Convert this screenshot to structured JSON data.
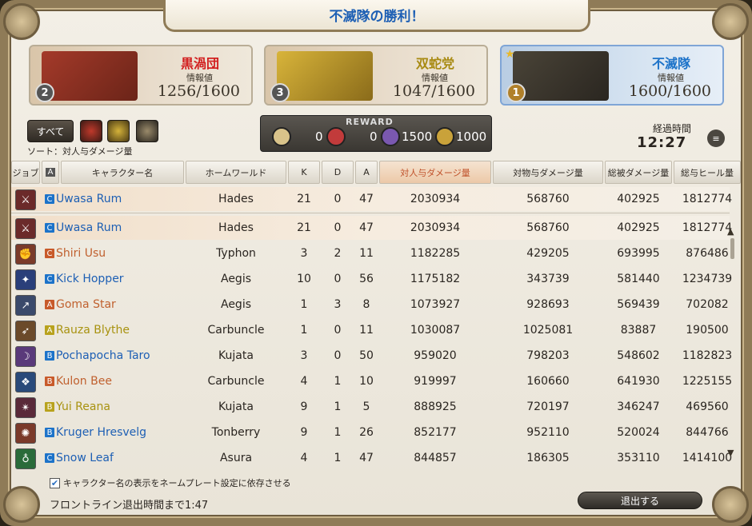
{
  "title": "不滅隊の勝利！",
  "teams": [
    {
      "name": "黒渦団",
      "info_label": "情報値",
      "score": "1256/1600",
      "rank": "2",
      "color": "#d21f1f"
    },
    {
      "name": "双蛇党",
      "info_label": "情報値",
      "score": "1047/1600",
      "rank": "3",
      "color": "#a88a12"
    },
    {
      "name": "不滅隊",
      "info_label": "情報値",
      "score": "1600/1600",
      "rank": "1",
      "color": "#1d73c9"
    }
  ],
  "filters": {
    "all_label": "すべて"
  },
  "sort_label": "ソート：対人与ダメージ量",
  "reward": {
    "label": "REWARD",
    "items": [
      {
        "value": "0",
        "color": "#d9c38a"
      },
      {
        "value": "0",
        "color": "#c23b3b"
      },
      {
        "value": "1500",
        "color": "#7a58b0"
      },
      {
        "value": "1000",
        "color": "#c9a23a"
      }
    ]
  },
  "elapsed": {
    "label": "経過時間",
    "value": "12:27"
  },
  "columns": {
    "job": "ジョブ",
    "alliance": "A",
    "name": "キャラクター名",
    "world": "ホームワールド",
    "k": "K",
    "d": "D",
    "a": "A",
    "pvp_damage": "対人与ダメージ量",
    "object_damage": "対物与ダメージ量",
    "damage_taken": "総被ダメージ量",
    "healing": "総与ヒール量"
  },
  "self_row": {
    "job_color": "#6b2a2a",
    "alliance": "C",
    "alliance_color": "#1d73c9",
    "name": "Uwasa Rum",
    "name_color": "#1d5fb4",
    "world": "Hades",
    "k": "21",
    "d": "0",
    "a": "47",
    "pvp_damage": "2030934",
    "object_damage": "568760",
    "damage_taken": "402925",
    "healing": "1812774"
  },
  "rows": [
    {
      "job_color": "#6b2a2a",
      "alliance": "C",
      "alliance_color": "#1d73c9",
      "name": "Uwasa Rum",
      "name_color": "#1d5fb4",
      "world": "Hades",
      "k": "21",
      "d": "0",
      "a": "47",
      "pvp_damage": "2030934",
      "object_damage": "568760",
      "damage_taken": "402925",
      "healing": "1812774"
    },
    {
      "job_color": "#7a3b2a",
      "alliance": "C",
      "alliance_color": "#c85a2a",
      "name": "Shiri Usu",
      "name_color": "#c0602e",
      "world": "Typhon",
      "k": "3",
      "d": "2",
      "a": "11",
      "pvp_damage": "1182285",
      "object_damage": "429205",
      "damage_taken": "693995",
      "healing": "876486"
    },
    {
      "job_color": "#2a3f7a",
      "alliance": "C",
      "alliance_color": "#1d73c9",
      "name": "Kick Hopper",
      "name_color": "#1d5fb4",
      "world": "Aegis",
      "k": "10",
      "d": "0",
      "a": "56",
      "pvp_damage": "1175182",
      "object_damage": "343739",
      "damage_taken": "581440",
      "healing": "1234739"
    },
    {
      "job_color": "#3b4a6b",
      "alliance": "A",
      "alliance_color": "#c85a2a",
      "name": "Goma Star",
      "name_color": "#c0602e",
      "world": "Aegis",
      "k": "1",
      "d": "3",
      "a": "8",
      "pvp_damage": "1073927",
      "object_damage": "928693",
      "damage_taken": "569439",
      "healing": "702082"
    },
    {
      "job_color": "#6b4a2a",
      "alliance": "A",
      "alliance_color": "#b8a21d",
      "name": "Rauza Blythe",
      "name_color": "#a8920f",
      "world": "Carbuncle",
      "k": "1",
      "d": "0",
      "a": "11",
      "pvp_damage": "1030087",
      "object_damage": "1025081",
      "damage_taken": "83887",
      "healing": "190500"
    },
    {
      "job_color": "#5a3a7a",
      "alliance": "B",
      "alliance_color": "#1d73c9",
      "name": "Pochapocha Taro",
      "name_color": "#1d5fb4",
      "world": "Kujata",
      "k": "3",
      "d": "0",
      "a": "50",
      "pvp_damage": "959020",
      "object_damage": "798203",
      "damage_taken": "548602",
      "healing": "1182823"
    },
    {
      "job_color": "#2a4a7a",
      "alliance": "B",
      "alliance_color": "#c85a2a",
      "name": "Kulon Bee",
      "name_color": "#c0602e",
      "world": "Carbuncle",
      "k": "4",
      "d": "1",
      "a": "10",
      "pvp_damage": "919997",
      "object_damage": "160660",
      "damage_taken": "641930",
      "healing": "1225155"
    },
    {
      "job_color": "#5a2a3a",
      "alliance": "B",
      "alliance_color": "#b8a21d",
      "name": "Yui Reana",
      "name_color": "#a8920f",
      "world": "Kujata",
      "k": "9",
      "d": "1",
      "a": "5",
      "pvp_damage": "888925",
      "object_damage": "720197",
      "damage_taken": "346247",
      "healing": "469560"
    },
    {
      "job_color": "#7a3a2a",
      "alliance": "B",
      "alliance_color": "#1d73c9",
      "name": "Kruger Hresvelg",
      "name_color": "#1d5fb4",
      "world": "Tonberry",
      "k": "9",
      "d": "1",
      "a": "26",
      "pvp_damage": "852177",
      "object_damage": "952110",
      "damage_taken": "520024",
      "healing": "844766"
    },
    {
      "job_color": "#2a6b3a",
      "alliance": "C",
      "alliance_color": "#1d73c9",
      "name": "Snow Leaf",
      "name_color": "#1d5fb4",
      "world": "Asura",
      "k": "4",
      "d": "1",
      "a": "47",
      "pvp_damage": "844857",
      "object_damage": "186305",
      "damage_taken": "353110",
      "healing": "1414100"
    }
  ],
  "footer": {
    "checkbox_label": "キャラクター名の表示をネームプレート設定に依存させる",
    "timer_text": "フロントライン退出時間まで1:47",
    "exit_label": "退出する"
  }
}
